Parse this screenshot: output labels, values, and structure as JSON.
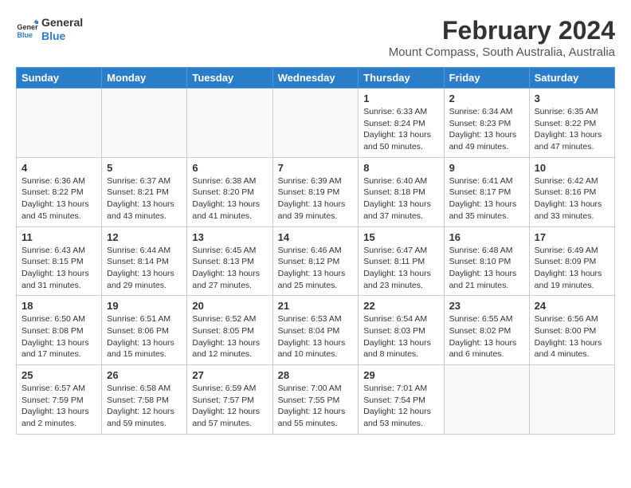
{
  "header": {
    "logo_line1": "General",
    "logo_line2": "Blue",
    "main_title": "February 2024",
    "sub_title": "Mount Compass, South Australia, Australia"
  },
  "calendar": {
    "headers": [
      "Sunday",
      "Monday",
      "Tuesday",
      "Wednesday",
      "Thursday",
      "Friday",
      "Saturday"
    ],
    "weeks": [
      [
        {
          "day": "",
          "info": ""
        },
        {
          "day": "",
          "info": ""
        },
        {
          "day": "",
          "info": ""
        },
        {
          "day": "",
          "info": ""
        },
        {
          "day": "1",
          "info": "Sunrise: 6:33 AM\nSunset: 8:24 PM\nDaylight: 13 hours\nand 50 minutes."
        },
        {
          "day": "2",
          "info": "Sunrise: 6:34 AM\nSunset: 8:23 PM\nDaylight: 13 hours\nand 49 minutes."
        },
        {
          "day": "3",
          "info": "Sunrise: 6:35 AM\nSunset: 8:22 PM\nDaylight: 13 hours\nand 47 minutes."
        }
      ],
      [
        {
          "day": "4",
          "info": "Sunrise: 6:36 AM\nSunset: 8:22 PM\nDaylight: 13 hours\nand 45 minutes."
        },
        {
          "day": "5",
          "info": "Sunrise: 6:37 AM\nSunset: 8:21 PM\nDaylight: 13 hours\nand 43 minutes."
        },
        {
          "day": "6",
          "info": "Sunrise: 6:38 AM\nSunset: 8:20 PM\nDaylight: 13 hours\nand 41 minutes."
        },
        {
          "day": "7",
          "info": "Sunrise: 6:39 AM\nSunset: 8:19 PM\nDaylight: 13 hours\nand 39 minutes."
        },
        {
          "day": "8",
          "info": "Sunrise: 6:40 AM\nSunset: 8:18 PM\nDaylight: 13 hours\nand 37 minutes."
        },
        {
          "day": "9",
          "info": "Sunrise: 6:41 AM\nSunset: 8:17 PM\nDaylight: 13 hours\nand 35 minutes."
        },
        {
          "day": "10",
          "info": "Sunrise: 6:42 AM\nSunset: 8:16 PM\nDaylight: 13 hours\nand 33 minutes."
        }
      ],
      [
        {
          "day": "11",
          "info": "Sunrise: 6:43 AM\nSunset: 8:15 PM\nDaylight: 13 hours\nand 31 minutes."
        },
        {
          "day": "12",
          "info": "Sunrise: 6:44 AM\nSunset: 8:14 PM\nDaylight: 13 hours\nand 29 minutes."
        },
        {
          "day": "13",
          "info": "Sunrise: 6:45 AM\nSunset: 8:13 PM\nDaylight: 13 hours\nand 27 minutes."
        },
        {
          "day": "14",
          "info": "Sunrise: 6:46 AM\nSunset: 8:12 PM\nDaylight: 13 hours\nand 25 minutes."
        },
        {
          "day": "15",
          "info": "Sunrise: 6:47 AM\nSunset: 8:11 PM\nDaylight: 13 hours\nand 23 minutes."
        },
        {
          "day": "16",
          "info": "Sunrise: 6:48 AM\nSunset: 8:10 PM\nDaylight: 13 hours\nand 21 minutes."
        },
        {
          "day": "17",
          "info": "Sunrise: 6:49 AM\nSunset: 8:09 PM\nDaylight: 13 hours\nand 19 minutes."
        }
      ],
      [
        {
          "day": "18",
          "info": "Sunrise: 6:50 AM\nSunset: 8:08 PM\nDaylight: 13 hours\nand 17 minutes."
        },
        {
          "day": "19",
          "info": "Sunrise: 6:51 AM\nSunset: 8:06 PM\nDaylight: 13 hours\nand 15 minutes."
        },
        {
          "day": "20",
          "info": "Sunrise: 6:52 AM\nSunset: 8:05 PM\nDaylight: 13 hours\nand 12 minutes."
        },
        {
          "day": "21",
          "info": "Sunrise: 6:53 AM\nSunset: 8:04 PM\nDaylight: 13 hours\nand 10 minutes."
        },
        {
          "day": "22",
          "info": "Sunrise: 6:54 AM\nSunset: 8:03 PM\nDaylight: 13 hours\nand 8 minutes."
        },
        {
          "day": "23",
          "info": "Sunrise: 6:55 AM\nSunset: 8:02 PM\nDaylight: 13 hours\nand 6 minutes."
        },
        {
          "day": "24",
          "info": "Sunrise: 6:56 AM\nSunset: 8:00 PM\nDaylight: 13 hours\nand 4 minutes."
        }
      ],
      [
        {
          "day": "25",
          "info": "Sunrise: 6:57 AM\nSunset: 7:59 PM\nDaylight: 13 hours\nand 2 minutes."
        },
        {
          "day": "26",
          "info": "Sunrise: 6:58 AM\nSunset: 7:58 PM\nDaylight: 12 hours\nand 59 minutes."
        },
        {
          "day": "27",
          "info": "Sunrise: 6:59 AM\nSunset: 7:57 PM\nDaylight: 12 hours\nand 57 minutes."
        },
        {
          "day": "28",
          "info": "Sunrise: 7:00 AM\nSunset: 7:55 PM\nDaylight: 12 hours\nand 55 minutes."
        },
        {
          "day": "29",
          "info": "Sunrise: 7:01 AM\nSunset: 7:54 PM\nDaylight: 12 hours\nand 53 minutes."
        },
        {
          "day": "",
          "info": ""
        },
        {
          "day": "",
          "info": ""
        }
      ]
    ]
  }
}
